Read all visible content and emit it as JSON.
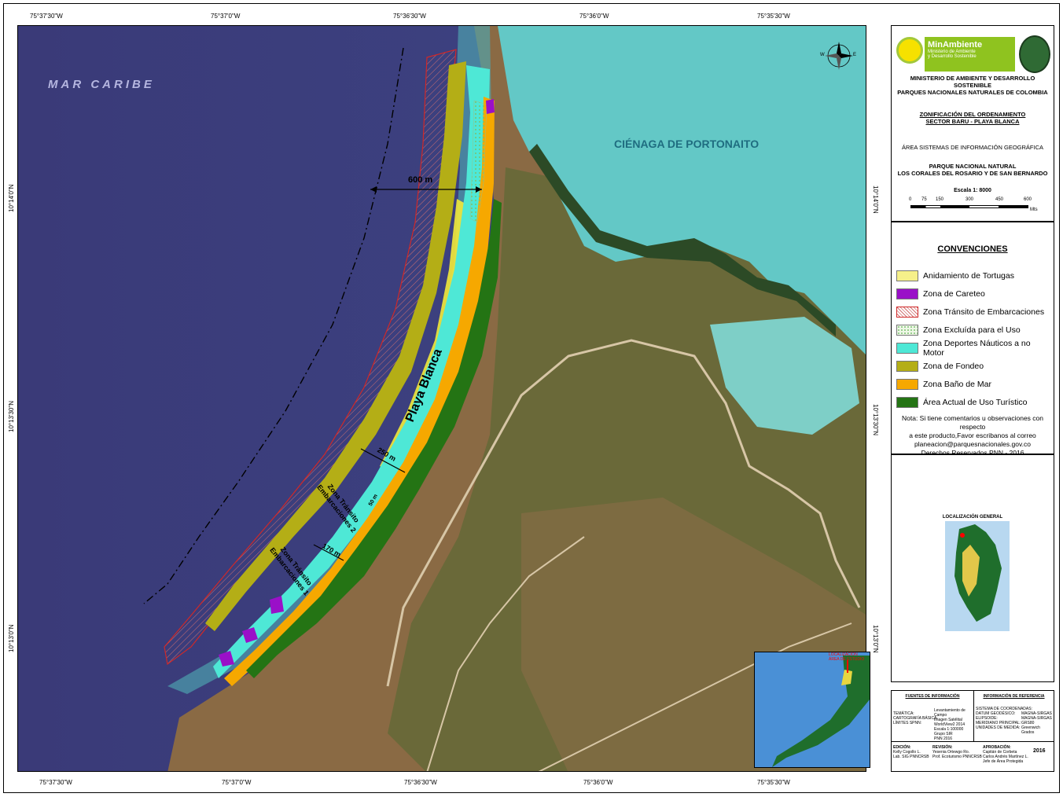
{
  "coords": {
    "top": [
      "75°37'30\"W",
      "75°37'0\"W",
      "75°36'30\"W",
      "75°36'0\"W",
      "75°35'30\"W"
    ],
    "bottom": [
      "75°37'30\"W",
      "75°37'0\"W",
      "75°36'30\"W",
      "75°36'0\"W",
      "75°35'30\"W"
    ],
    "left": [
      "10°14'0\"N",
      "10°13'30\"N",
      "10°13'0\"N"
    ],
    "right": [
      "10°14'0\"N",
      "10°13'30\"N",
      "10°13'0\"N"
    ]
  },
  "map_labels": {
    "sea": "MAR CARIBE",
    "lagoon": "CIÉNAGA DE PORTONAITO",
    "beach": "Playa Blanca",
    "dist_600": "600 m",
    "dist_250": "250 m",
    "dist_170": "170 m",
    "dist_50": "50 m",
    "zone2_line1": "Zona Tránsito",
    "zone2_line2": "Embarcaciones 2",
    "zone1_line1": "Zona Tránsito",
    "zone1_line2": "Embarcaciones 1",
    "north_w": "W",
    "north_e": "E"
  },
  "header": {
    "brand": "MinAmbiente",
    "brand_sub1": "Ministerio de Ambiente",
    "brand_sub2": "y Desarrollo Sostenible",
    "ministry1": "MINISTERIO DE AMBIENTE Y DESARROLLO SOSTENIBLE",
    "ministry2": "PARQUES NACIONALES NATURALES DE COLOMBIA",
    "map_title1": "ZONIFICACIÓN DEL ORDENAMIENTO",
    "map_title2": "SECTOR BARU - PLAYA BLANCA",
    "area": "ÁREA SISTEMAS DE INFORMACIÓN GEOGRÁFICA",
    "park1": "PARQUE NACIONAL NATURAL",
    "park2": "LOS CORALES DEL ROSARIO Y DE SAN BERNARDO",
    "scale": "Escala 1: 8000",
    "scale_ticks": [
      "0",
      "75",
      "150",
      "300",
      "450",
      "600"
    ],
    "scale_unit": "Mts"
  },
  "legend": {
    "title": "CONVENCIONES",
    "items": [
      {
        "label": "Anidamiento de Tortugas",
        "color": "#f6f08a"
      },
      {
        "label": "Zona de Careteo",
        "color": "#9a10c8"
      },
      {
        "label": "Zona Tránsito de Embarcaciones",
        "color": "#f4c8c8"
      },
      {
        "label": "Zona Excluída para el Uso",
        "color": "#d4ecc8"
      },
      {
        "label": "Zona Deportes Náuticos a no Motor",
        "color": "#4ee8d6"
      },
      {
        "label": "Zona de Fondeo",
        "color": "#b4ae16"
      },
      {
        "label": "Zona Baño de Mar",
        "color": "#f6a800"
      },
      {
        "label": "Área Actual de Uso Turístico",
        "color": "#247414"
      }
    ],
    "note1": "Nota: Si tiene comentarios u observaciones con respecto",
    "note2": "a este producto,Favor escribanos al correo",
    "note3": "planeacion@parquesnacionales.gov.co",
    "note4": "Derechos Reservados PNN - 2016"
  },
  "location": {
    "title": "LOCALIZACIÓN GENERAL",
    "inset_label1": "LOCALIZACIÓN",
    "inset_label2": "ÁREA DE ESTUDIO"
  },
  "footer": {
    "sources_title": "FUENTES DE INFORMACIÓN",
    "ref_title": "INFORMACIÓN DE REFERENCIA",
    "sources_keys": [
      "TEMÁTICA:",
      "CARTOGRAFÍA BÁSICA:",
      "",
      "",
      "LÍMITES SPNN:"
    ],
    "sources_vals": [
      "Levantamiento de Campo",
      "Imagen Satélital",
      "WorldView2 2014",
      "Escala 1:100000",
      "Grupo SIR",
      "PNN 2016"
    ],
    "ref_keys": [
      "SISTEMA DE COORDENADAS:",
      "DATUM GEODÉSICO:",
      "ELIPSOIDE:",
      "MERIDIANO PRINCIPAL:",
      "UNIDADES DE MEDIDA:"
    ],
    "ref_vals": [
      "MAGNA-SIRGAS",
      "MAGNA-SIRGAS",
      "GRS80",
      "Greenwich",
      "Grados"
    ],
    "edition_key": "EDICIÓN:",
    "edition_vals": [
      "Kelly Cogollo L.",
      "Lab. SIG PNNCRSB"
    ],
    "review_key": "REVISIÓN:",
    "review_vals": [
      "Yesenia Ortewgo Ro.",
      "Prof. Ecoturismo PNNCRSB"
    ],
    "approval_key": "APROBACIÓN:",
    "approval_vals": [
      "Capitán de Corbeta",
      "Carlos Andrés Martínez L.",
      "Jefe de Área Protegida"
    ],
    "year": "2016"
  }
}
